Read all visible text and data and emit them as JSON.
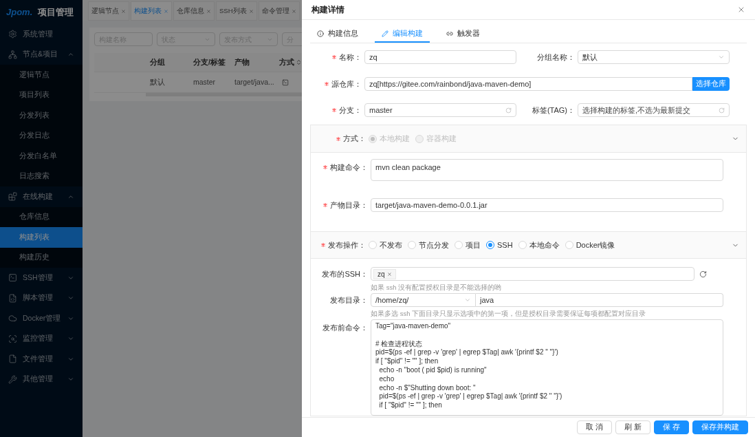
{
  "sidebar": {
    "logo": "Jpom.",
    "title": "项目管理",
    "items": [
      {
        "label": "系统管理",
        "selected": false
      },
      {
        "label": "节点&项目",
        "selected": false,
        "expanded": true,
        "children": [
          {
            "label": "逻辑节点",
            "selected": false
          },
          {
            "label": "项目列表",
            "selected": false
          },
          {
            "label": "分发列表",
            "selected": false
          },
          {
            "label": "分发日志",
            "selected": false
          },
          {
            "label": "分发白名单",
            "selected": false
          },
          {
            "label": "日志搜索",
            "selected": false
          }
        ]
      },
      {
        "label": "在线构建",
        "selected": false,
        "expanded": true,
        "children": [
          {
            "label": "仓库信息",
            "selected": false
          },
          {
            "label": "构建列表",
            "selected": true
          },
          {
            "label": "构建历史",
            "selected": false
          }
        ]
      },
      {
        "label": "SSH管理",
        "selected": false,
        "expanded": false
      },
      {
        "label": "脚本管理",
        "selected": false,
        "expanded": false
      },
      {
        "label": "Docker管理",
        "selected": false,
        "expanded": false
      },
      {
        "label": "监控管理",
        "selected": false,
        "expanded": false
      },
      {
        "label": "文件管理",
        "selected": false,
        "expanded": false
      },
      {
        "label": "其他管理",
        "selected": false,
        "expanded": false
      }
    ]
  },
  "tabs": [
    {
      "label": "逻辑节点",
      "selected": false
    },
    {
      "label": "构建列表",
      "selected": true
    },
    {
      "label": "仓库信息",
      "selected": false
    },
    {
      "label": "SSH列表",
      "selected": false
    },
    {
      "label": "命令管理",
      "selected": false
    }
  ],
  "filters": [
    {
      "placeholder": "构建名称",
      "kind": "input"
    },
    {
      "placeholder": "状态",
      "kind": "select"
    },
    {
      "placeholder": "发布方式",
      "kind": "select"
    },
    {
      "placeholder": "分",
      "kind": "input"
    }
  ],
  "table": {
    "columns": [
      "分组",
      "分支/标签",
      "产物",
      "方式"
    ],
    "rows": [
      [
        "默认",
        "master",
        "target/java..."
      ]
    ]
  },
  "drawer": {
    "title": "构建详情",
    "tabs": [
      {
        "label": "构建信息",
        "selected": false
      },
      {
        "label": "编辑构建",
        "selected": true
      },
      {
        "label": "触发器",
        "selected": false
      }
    ],
    "name": {
      "label": "名称：",
      "required": true,
      "value": "zq"
    },
    "group": {
      "label": "分组名称：",
      "value": "默认"
    },
    "repo": {
      "label": "源仓库：",
      "required": true,
      "value": "zq[https://gitee.com/rainbond/java-maven-demo]",
      "button": "选择仓库"
    },
    "branch": {
      "label": "分支：",
      "required": true,
      "value": "master"
    },
    "tag": {
      "label": "标签(TAG)：",
      "placeholder": "选择构建的标签,不选为最新提交"
    },
    "method": {
      "label": "方式：",
      "required": true,
      "options": [
        {
          "label": "本地构建",
          "selected": true,
          "disabled": true
        },
        {
          "label": "容器构建",
          "selected": false,
          "disabled": true
        }
      ]
    },
    "build_command": {
      "label": "构建命令：",
      "required": true,
      "value": "mvn clean package"
    },
    "artifact": {
      "label": "产物目录：",
      "required": true,
      "value": "target/java-maven-demo-0.0.1.jar"
    },
    "publish": {
      "label": "发布操作：",
      "required": true,
      "options": [
        {
          "label": "不发布",
          "selected": false,
          "disabled": false
        },
        {
          "label": "节点分发",
          "selected": false,
          "disabled": false
        },
        {
          "label": "项目",
          "selected": false,
          "disabled": false
        },
        {
          "label": "SSH",
          "selected": true,
          "disabled": false
        },
        {
          "label": "本地命令",
          "selected": false,
          "disabled": false
        },
        {
          "label": "Docker镜像",
          "selected": false,
          "disabled": false
        }
      ]
    },
    "ssh": {
      "label": "发布的SSH：",
      "tags": [
        "zq"
      ],
      "hint": "如果 ssh 没有配置授权目录是不能选择的哟"
    },
    "dir": {
      "label": "发布目录：",
      "select": "/home/zq/",
      "value": "java",
      "hint": "如果多选 ssh 下面目录只显示选项中的第一项，但是授权目录需要保证每项都配置对应目录"
    },
    "pre_command": {
      "label": "发布前命令：",
      "value": "Tag=\"java-maven-demo\"\n\n# 检查进程状态\npid=$(ps -ef | grep -v 'grep' | egrep $Tag| awk '{printf $2 \" \"}')\nif [ \"$pid\" != \"\" ]; then\n  echo -n \"boot ( pid $pid) is running\"\n  echo\n  echo -n $\"Shutting down boot: \"\n  pid=$(ps -ef | grep -v 'grep' | egrep $Tag| awk '{printf $2 \" \"}')\n  if [ \"$pid\" != \"\" ]; then"
    },
    "buttons": [
      {
        "label": "取 消",
        "kind": "default"
      },
      {
        "label": "刷 新",
        "kind": "default"
      },
      {
        "label": "保 存",
        "kind": "primary"
      },
      {
        "label": "保存并构建",
        "kind": "primary"
      }
    ]
  }
}
